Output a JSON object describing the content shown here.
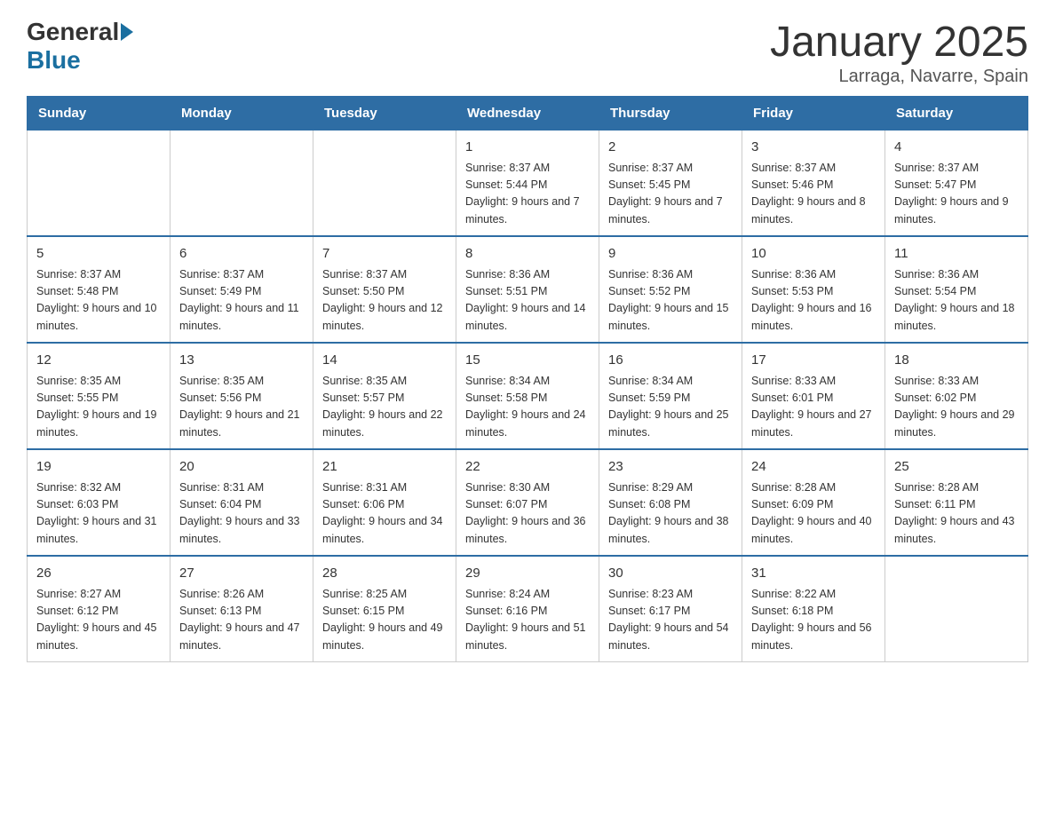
{
  "header": {
    "logo_general": "General",
    "logo_blue": "Blue",
    "title": "January 2025",
    "location": "Larraga, Navarre, Spain"
  },
  "days_of_week": [
    "Sunday",
    "Monday",
    "Tuesday",
    "Wednesday",
    "Thursday",
    "Friday",
    "Saturday"
  ],
  "weeks": [
    [
      {
        "day": "",
        "info": ""
      },
      {
        "day": "",
        "info": ""
      },
      {
        "day": "",
        "info": ""
      },
      {
        "day": "1",
        "info": "Sunrise: 8:37 AM\nSunset: 5:44 PM\nDaylight: 9 hours and 7 minutes."
      },
      {
        "day": "2",
        "info": "Sunrise: 8:37 AM\nSunset: 5:45 PM\nDaylight: 9 hours and 7 minutes."
      },
      {
        "day": "3",
        "info": "Sunrise: 8:37 AM\nSunset: 5:46 PM\nDaylight: 9 hours and 8 minutes."
      },
      {
        "day": "4",
        "info": "Sunrise: 8:37 AM\nSunset: 5:47 PM\nDaylight: 9 hours and 9 minutes."
      }
    ],
    [
      {
        "day": "5",
        "info": "Sunrise: 8:37 AM\nSunset: 5:48 PM\nDaylight: 9 hours and 10 minutes."
      },
      {
        "day": "6",
        "info": "Sunrise: 8:37 AM\nSunset: 5:49 PM\nDaylight: 9 hours and 11 minutes."
      },
      {
        "day": "7",
        "info": "Sunrise: 8:37 AM\nSunset: 5:50 PM\nDaylight: 9 hours and 12 minutes."
      },
      {
        "day": "8",
        "info": "Sunrise: 8:36 AM\nSunset: 5:51 PM\nDaylight: 9 hours and 14 minutes."
      },
      {
        "day": "9",
        "info": "Sunrise: 8:36 AM\nSunset: 5:52 PM\nDaylight: 9 hours and 15 minutes."
      },
      {
        "day": "10",
        "info": "Sunrise: 8:36 AM\nSunset: 5:53 PM\nDaylight: 9 hours and 16 minutes."
      },
      {
        "day": "11",
        "info": "Sunrise: 8:36 AM\nSunset: 5:54 PM\nDaylight: 9 hours and 18 minutes."
      }
    ],
    [
      {
        "day": "12",
        "info": "Sunrise: 8:35 AM\nSunset: 5:55 PM\nDaylight: 9 hours and 19 minutes."
      },
      {
        "day": "13",
        "info": "Sunrise: 8:35 AM\nSunset: 5:56 PM\nDaylight: 9 hours and 21 minutes."
      },
      {
        "day": "14",
        "info": "Sunrise: 8:35 AM\nSunset: 5:57 PM\nDaylight: 9 hours and 22 minutes."
      },
      {
        "day": "15",
        "info": "Sunrise: 8:34 AM\nSunset: 5:58 PM\nDaylight: 9 hours and 24 minutes."
      },
      {
        "day": "16",
        "info": "Sunrise: 8:34 AM\nSunset: 5:59 PM\nDaylight: 9 hours and 25 minutes."
      },
      {
        "day": "17",
        "info": "Sunrise: 8:33 AM\nSunset: 6:01 PM\nDaylight: 9 hours and 27 minutes."
      },
      {
        "day": "18",
        "info": "Sunrise: 8:33 AM\nSunset: 6:02 PM\nDaylight: 9 hours and 29 minutes."
      }
    ],
    [
      {
        "day": "19",
        "info": "Sunrise: 8:32 AM\nSunset: 6:03 PM\nDaylight: 9 hours and 31 minutes."
      },
      {
        "day": "20",
        "info": "Sunrise: 8:31 AM\nSunset: 6:04 PM\nDaylight: 9 hours and 33 minutes."
      },
      {
        "day": "21",
        "info": "Sunrise: 8:31 AM\nSunset: 6:06 PM\nDaylight: 9 hours and 34 minutes."
      },
      {
        "day": "22",
        "info": "Sunrise: 8:30 AM\nSunset: 6:07 PM\nDaylight: 9 hours and 36 minutes."
      },
      {
        "day": "23",
        "info": "Sunrise: 8:29 AM\nSunset: 6:08 PM\nDaylight: 9 hours and 38 minutes."
      },
      {
        "day": "24",
        "info": "Sunrise: 8:28 AM\nSunset: 6:09 PM\nDaylight: 9 hours and 40 minutes."
      },
      {
        "day": "25",
        "info": "Sunrise: 8:28 AM\nSunset: 6:11 PM\nDaylight: 9 hours and 43 minutes."
      }
    ],
    [
      {
        "day": "26",
        "info": "Sunrise: 8:27 AM\nSunset: 6:12 PM\nDaylight: 9 hours and 45 minutes."
      },
      {
        "day": "27",
        "info": "Sunrise: 8:26 AM\nSunset: 6:13 PM\nDaylight: 9 hours and 47 minutes."
      },
      {
        "day": "28",
        "info": "Sunrise: 8:25 AM\nSunset: 6:15 PM\nDaylight: 9 hours and 49 minutes."
      },
      {
        "day": "29",
        "info": "Sunrise: 8:24 AM\nSunset: 6:16 PM\nDaylight: 9 hours and 51 minutes."
      },
      {
        "day": "30",
        "info": "Sunrise: 8:23 AM\nSunset: 6:17 PM\nDaylight: 9 hours and 54 minutes."
      },
      {
        "day": "31",
        "info": "Sunrise: 8:22 AM\nSunset: 6:18 PM\nDaylight: 9 hours and 56 minutes."
      },
      {
        "day": "",
        "info": ""
      }
    ]
  ]
}
